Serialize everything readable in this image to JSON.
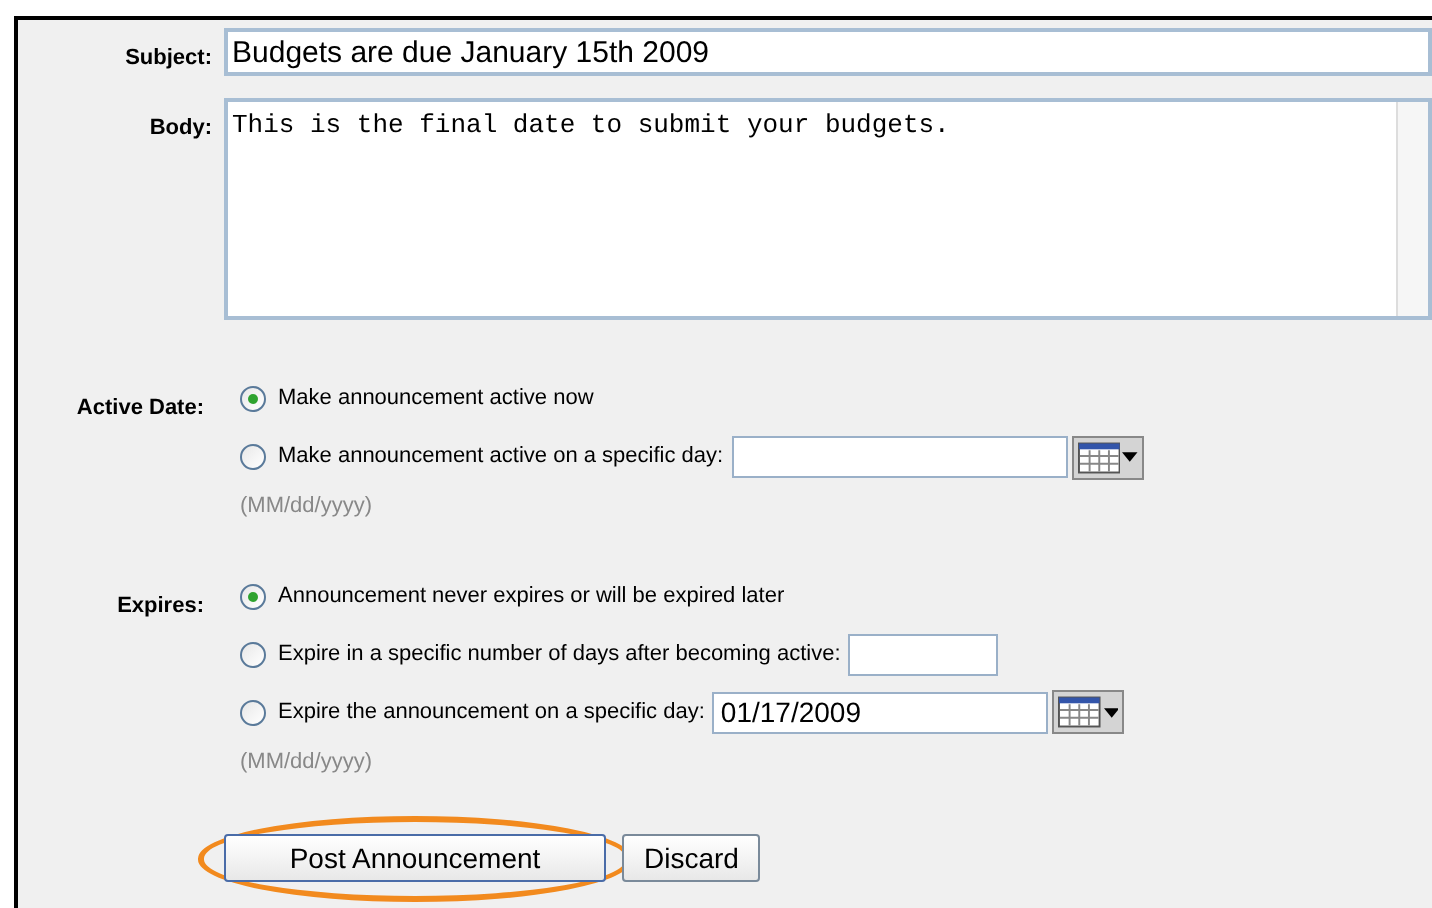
{
  "subject": {
    "label": "Subject:",
    "value": "Budgets are due January 15th 2009"
  },
  "body": {
    "label": "Body:",
    "value": "This is the final date to submit your budgets."
  },
  "active_date": {
    "label": "Active Date:",
    "options": [
      {
        "kind": "plain",
        "label": "Make announcement active now",
        "selected": true
      },
      {
        "kind": "date",
        "label": "Make announcement active on a specific day:",
        "selected": false
      }
    ],
    "hint": "(MM/dd/yyyy)"
  },
  "expires": {
    "label": "Expires:",
    "options": [
      {
        "kind": "plain",
        "label": "Announcement never expires or will be expired later",
        "selected": true
      },
      {
        "kind": "number",
        "label": "Expire in a specific number of days after becoming active:",
        "selected": false
      },
      {
        "kind": "date",
        "label": "Expire the announcement on a specific day:",
        "value": "01/17/2009",
        "selected": false
      }
    ],
    "hint": "(MM/dd/yyyy)"
  },
  "buttons": [
    {
      "label": "Post Announcement",
      "highlighted": true
    },
    {
      "label": "Discard",
      "highlighted": false
    }
  ]
}
